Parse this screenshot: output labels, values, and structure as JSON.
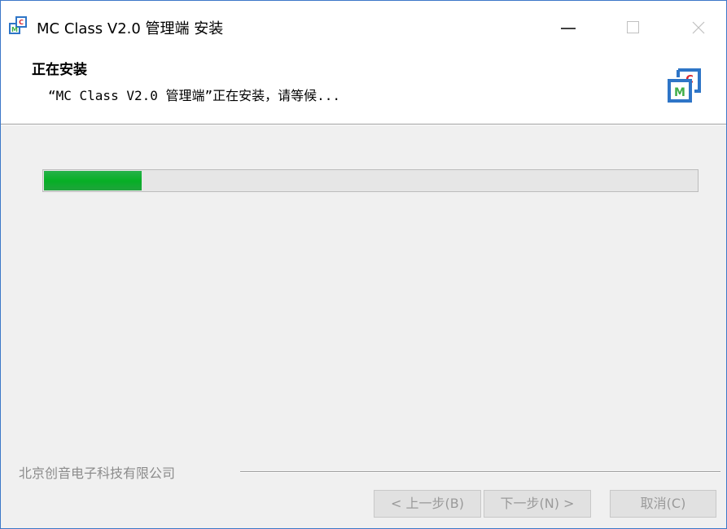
{
  "window": {
    "title": "MC Class V2.0 管理端 安装"
  },
  "header": {
    "title": "正在安装",
    "subtitle": "“MC Class V2.0 管理端”正在安装，请等候...",
    "logo_letters": [
      "C",
      "M"
    ]
  },
  "progress": {
    "percent": 15
  },
  "footer": {
    "brand": "北京创音电子科技有限公司"
  },
  "buttons": {
    "back": "< 上一步(B)",
    "next": "下一步(N) >",
    "cancel": "取消(C)"
  },
  "colors": {
    "progress_fill": "#06b025",
    "logo_blue": "#2e75c7",
    "logo_red": "#d8262e",
    "logo_green": "#3fae49",
    "window_border": "#3c78c8"
  }
}
